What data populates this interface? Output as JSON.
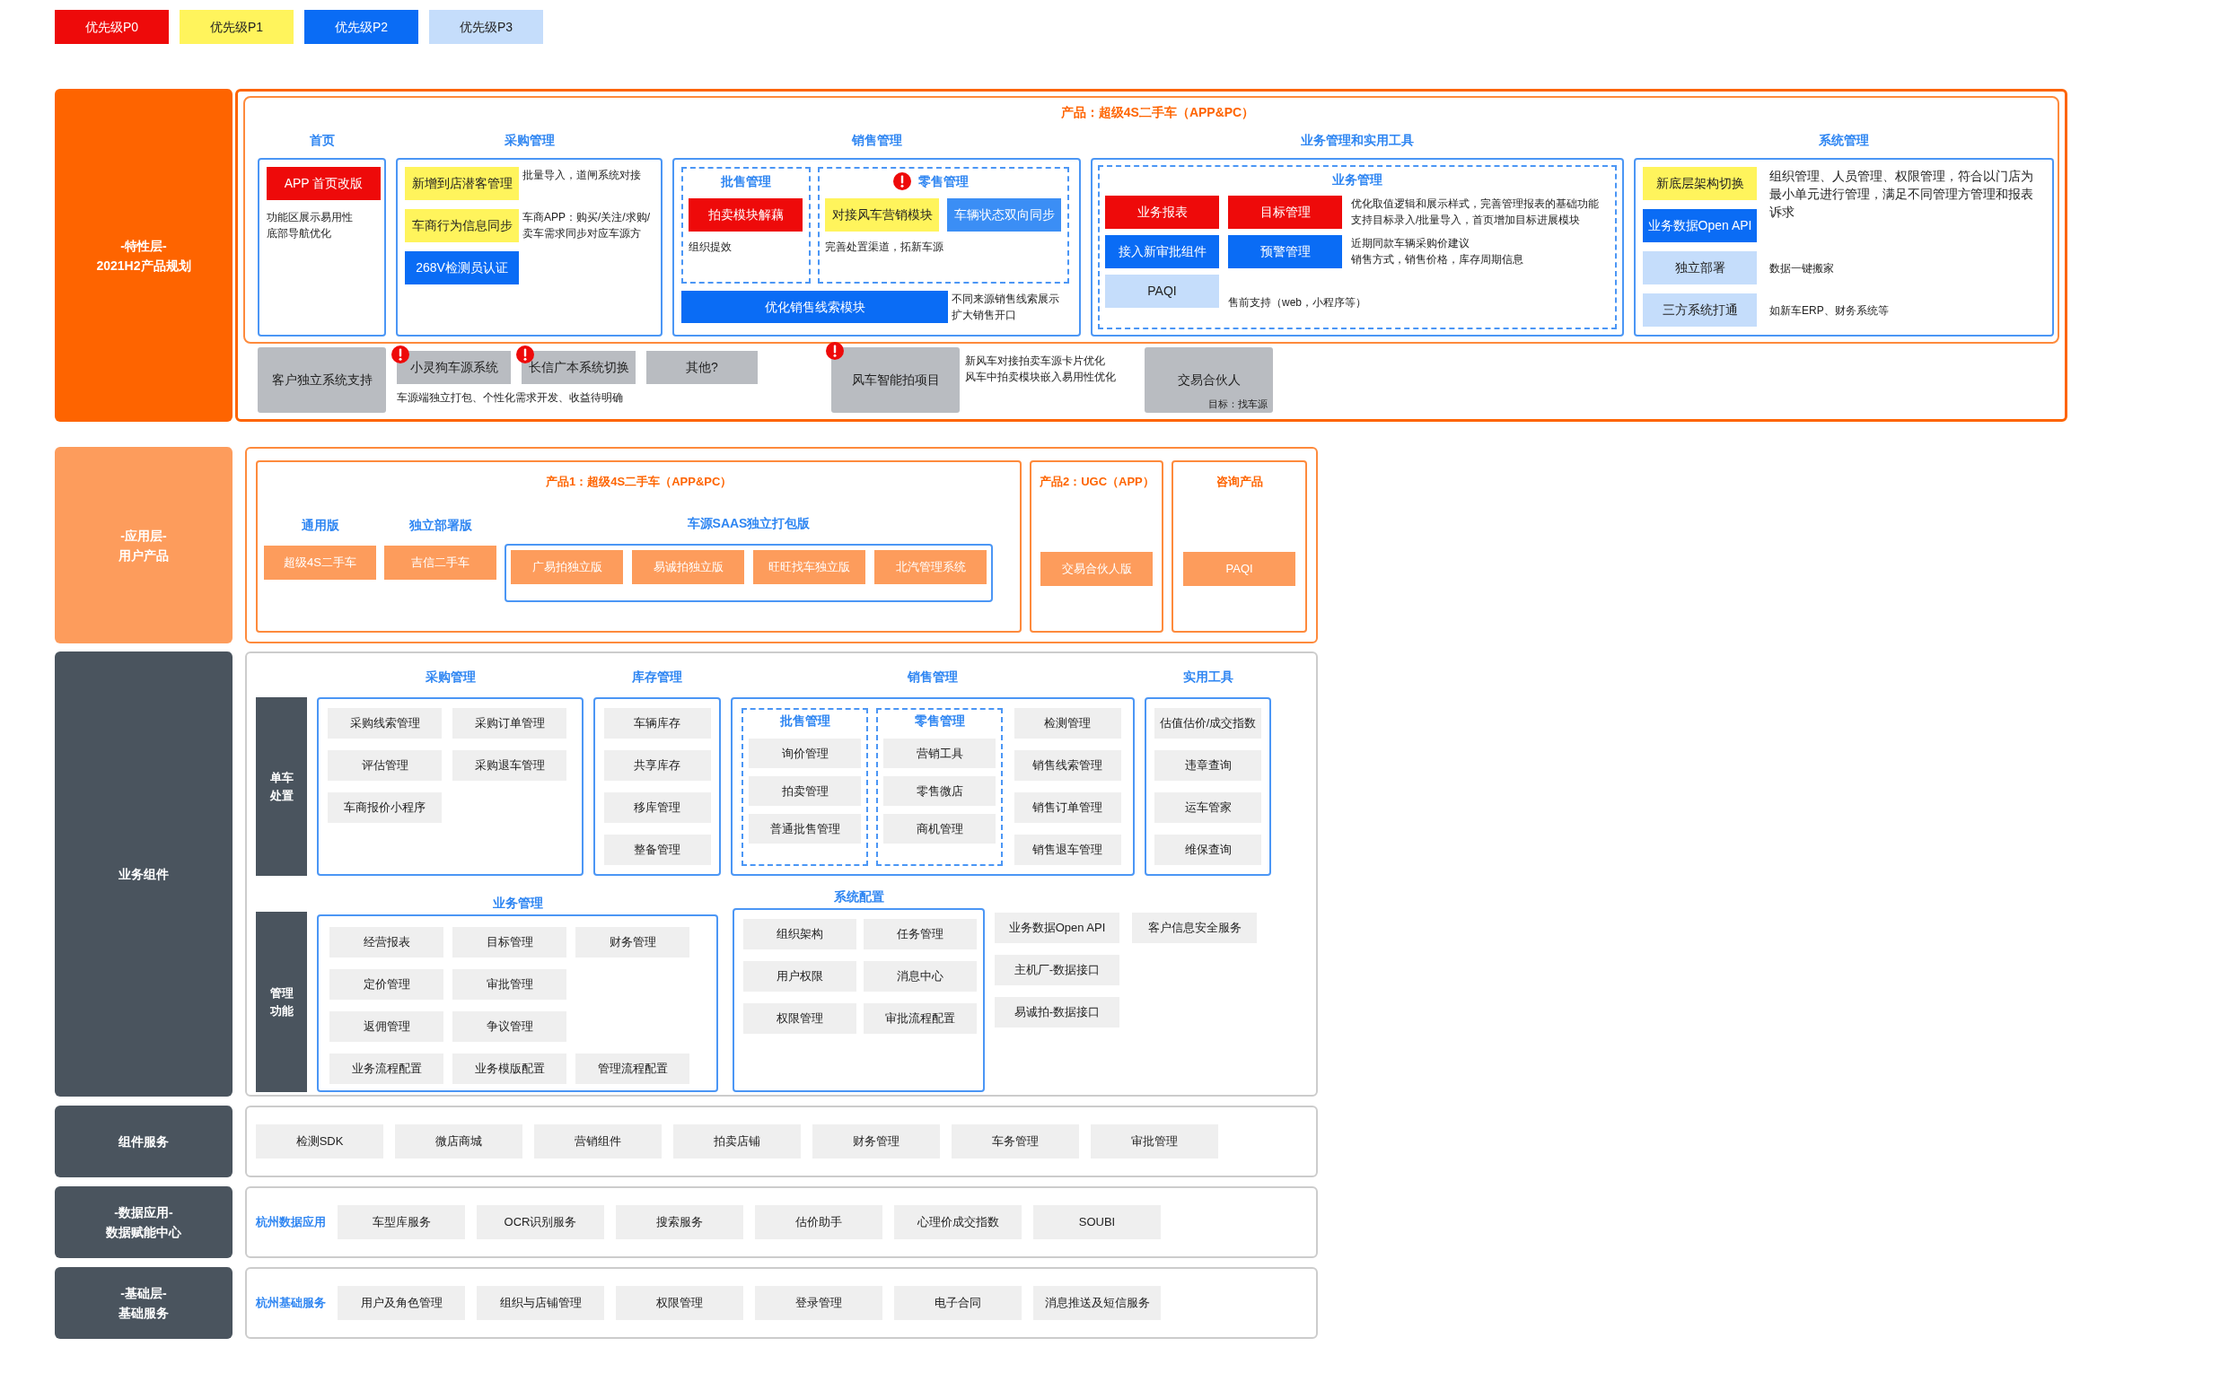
{
  "legend": [
    {
      "label": "优先级P0",
      "color": "#ee0a0a"
    },
    {
      "label": "优先级P1",
      "color": "#fff45c"
    },
    {
      "label": "优先级P2",
      "color": "#0a6cf5"
    },
    {
      "label": "优先级P3",
      "color": "#c5ddfb"
    }
  ],
  "feature_layer": {
    "label_lines": [
      "-特性层-",
      "2021H2产品规划"
    ],
    "product_title": "产品：超级4S二手车（APP&PC）",
    "home": {
      "title": "首页",
      "items": [
        {
          "label": "APP 首页改版",
          "color": "#ee0a0a"
        }
      ],
      "note_lines": [
        "功能区展示易用性",
        "底部导航优化"
      ]
    },
    "purchase": {
      "title": "采购管理",
      "rows": [
        {
          "label": "新增到店潜客管理",
          "color": "#fff45c",
          "note_lines": [
            "批量导入，道闸系统对接"
          ]
        },
        {
          "label": "车商行为信息同步",
          "color": "#fff45c",
          "note_lines": [
            "车商APP：购买/关注/求购/",
            "卖车需求同步对应车源方"
          ]
        },
        {
          "label": "268V检测员认证",
          "color": "#0a6cf5"
        }
      ]
    },
    "sales": {
      "title": "销售管理",
      "groups": [
        {
          "title": "批售管理",
          "alert": false,
          "items": [
            {
              "label": "拍卖模块解藕",
              "color": "#ee0a0a"
            }
          ],
          "note": "组织提效"
        },
        {
          "title": "零售管理",
          "alert": true,
          "items": [
            {
              "label": "对接风车营销模块",
              "color": "#fff45c"
            },
            {
              "label": "车辆状态双向同步",
              "color": "#3b8ef5"
            }
          ],
          "note": "完善处置渠道，拓新车源"
        }
      ],
      "wide": {
        "label": "优化销售线索模块",
        "color": "#0a6cf5",
        "note_lines": [
          "不同来源销售线索展示",
          "扩大销售开口"
        ]
      }
    },
    "business_tools": {
      "title": "业务管理和实用工具",
      "group_title": "业务管理",
      "rows": [
        {
          "items": [
            {
              "label": "业务报表",
              "color": "#ee0a0a"
            },
            {
              "label": "目标管理",
              "color": "#ee0a0a"
            }
          ],
          "note_lines": [
            "优化取值逻辑和展示样式，完善管理报表的基础功能",
            "支持目标录入/批量导入，首页增加目标进展模块"
          ]
        },
        {
          "items": [
            {
              "label": "接入新审批组件",
              "color": "#0a6cf5"
            },
            {
              "label": "预警管理",
              "color": "#0a6cf5"
            }
          ],
          "note_lines": [
            "近期同款车辆采购价建议",
            "销售方式，销售价格，库存周期信息"
          ]
        },
        {
          "items": [
            {
              "label": "PAQI",
              "color": "#c5ddfb"
            }
          ],
          "note_lines": [
            "售前支持（web，小程序等）"
          ]
        }
      ]
    },
    "system": {
      "title": "系统管理",
      "note": "组织管理、人员管理、权限管理，符合以门店为最小单元进行管理，满足不同管理方管理和报表诉求",
      "rows": [
        {
          "label": "新底层架构切换",
          "color": "#fff45c"
        },
        {
          "label": "业务数据Open API",
          "color": "#0a6cf5"
        },
        {
          "label": "独立部署",
          "color": "#c5ddfb",
          "note": "数据一键搬家"
        },
        {
          "label": "三方系统打通",
          "color": "#c5ddfb",
          "note": "如新车ERP、财务系统等"
        }
      ]
    },
    "extras": [
      {
        "kind": "tall",
        "label": "客户独立系统支持",
        "alert": false
      },
      {
        "kind": "pair",
        "items": [
          {
            "label": "小灵狗车源系统",
            "alert": true
          },
          {
            "label": "长信广本系统切换",
            "alert": true
          }
        ],
        "note": "车源端独立打包、个性化需求开发、收益待明确"
      },
      {
        "kind": "short",
        "label": "其他?",
        "alert": false
      },
      {
        "kind": "tall",
        "label": "风车智能拍项目",
        "alert": true,
        "note_lines": [
          "新风车对接拍卖车源卡片优化",
          "风车中拍卖模块嵌入易用性优化"
        ]
      },
      {
        "kind": "tall",
        "label": "交易合伙人",
        "alert": false,
        "sub": "目标：找车源"
      }
    ]
  },
  "app_layer": {
    "label_lines": [
      "-应用层-",
      "用户产品"
    ],
    "products": [
      {
        "title": "产品1：超级4S二手车（APP&PC）",
        "groups": [
          {
            "title": "通用版",
            "kind": "plain",
            "items": [
              "超级4S二手车"
            ]
          },
          {
            "title": "独立部署版",
            "kind": "plain",
            "items": [
              "吉信二手车"
            ]
          },
          {
            "title": "车源SAAS独立打包版",
            "kind": "framed",
            "items": [
              "广易拍独立版",
              "易诚拍独立版",
              "旺旺找车独立版",
              "北汽管理系统"
            ]
          }
        ]
      },
      {
        "title": "产品2：UGC（APP）",
        "groups": [
          {
            "kind": "plain",
            "items": [
              "交易合伙人版"
            ]
          }
        ]
      },
      {
        "title": "咨询产品",
        "groups": [
          {
            "kind": "plain",
            "items": [
              "PAQI"
            ]
          }
        ]
      }
    ]
  },
  "business_layer": {
    "label_lines": [
      "业务组件"
    ],
    "vehicle": {
      "label": "单车处置",
      "groups": [
        {
          "title": "采购管理",
          "kind": "grid",
          "items": [
            "采购线索管理",
            "采购订单管理",
            "评估管理",
            "采购退车管理",
            "车商报价小程序"
          ]
        },
        {
          "title": "库存管理",
          "kind": "list",
          "items": [
            "车辆库存",
            "共享库存",
            "移库管理",
            "整备管理"
          ]
        },
        {
          "title": "销售管理",
          "kind": "split",
          "subgroups": [
            {
              "title": "批售管理",
              "items": [
                "询价管理",
                "拍卖管理",
                "普通批售管理"
              ]
            },
            {
              "title": "零售管理",
              "items": [
                "营销工具",
                "零售微店",
                "商机管理"
              ]
            }
          ],
          "items": [
            "检测管理",
            "销售线索管理",
            "销售订单管理",
            "销售退车管理"
          ]
        },
        {
          "title": "实用工具",
          "kind": "list",
          "items": [
            "估值估价/成交指数",
            "违章查询",
            "运车管家",
            "维保查询"
          ]
        }
      ]
    },
    "management": {
      "label": "管理功能",
      "business": {
        "title": "业务管理",
        "rows": [
          [
            "经营报表",
            "目标管理",
            "财务管理"
          ],
          [
            "定价管理",
            "审批管理"
          ],
          [
            "返佣管理",
            "争议管理"
          ],
          [
            "业务流程配置",
            "业务模版配置",
            "管理流程配置"
          ]
        ]
      },
      "system": {
        "title": "系统配置",
        "items": [
          "组织架构",
          "任务管理",
          "用户权限",
          "消息中心",
          "权限管理",
          "审批流程配置"
        ]
      },
      "loose": [
        [
          "业务数据Open API",
          "主机厂-数据接口",
          "易诚拍-数据接口"
        ],
        [
          "客户信息安全服务"
        ]
      ]
    }
  },
  "service_rows": [
    {
      "label_lines": [
        "组件服务"
      ],
      "items": [
        "检测SDK",
        "微店商城",
        "营销组件",
        "拍卖店铺",
        "财务管理",
        "车务管理",
        "审批管理"
      ]
    },
    {
      "label_lines": [
        "-数据应用-",
        "数据赋能中心"
      ],
      "prefix": "杭州数据应用",
      "items": [
        "车型库服务",
        "OCR识别服务",
        "搜索服务",
        "估价助手",
        "心理价成交指数",
        "SOUBI"
      ]
    },
    {
      "label_lines": [
        "-基础层-",
        "基础服务"
      ],
      "prefix": "杭州基础服务",
      "items": [
        "用户及角色管理",
        "组织与店铺管理",
        "权限管理",
        "登录管理",
        "电子合同",
        "消息推送及短信服务"
      ]
    }
  ]
}
